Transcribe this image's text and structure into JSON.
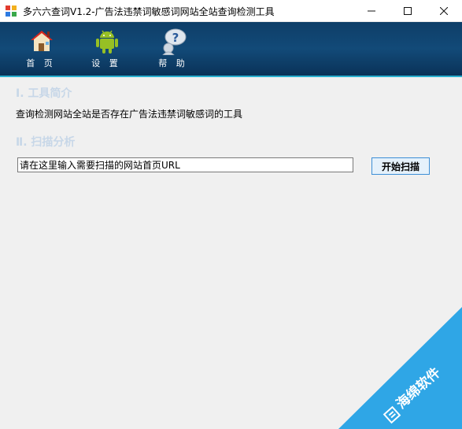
{
  "window": {
    "title": "多六六查词V1.2-广告法违禁词敏感词网站全站查询检测工具",
    "minimize": "—",
    "maximize": "☐",
    "close": "✕"
  },
  "toolbar": {
    "items": [
      {
        "label": "首 页",
        "icon": "house-icon"
      },
      {
        "label": "设 置",
        "icon": "android-icon"
      },
      {
        "label": "帮 助",
        "icon": "help-question-icon"
      }
    ]
  },
  "intro": {
    "heading": "Ⅰ. 工具简介",
    "text": "查询检测网站全站是否存在广告法违禁词敏感词的工具"
  },
  "scan": {
    "heading": "Ⅱ. 扫描分析",
    "input_value": "请在这里输入需要扫描的网站首页URL",
    "button_label": "开始扫描"
  },
  "watermark": {
    "text": "海绵软件",
    "color": "#2fa6e6"
  }
}
